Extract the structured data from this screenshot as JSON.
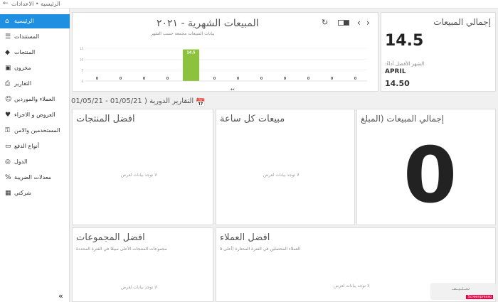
{
  "titlebar": {
    "back_icon": "arrow-left-icon",
    "breadcrumb": "الرئيسية • الاعدادات"
  },
  "sidebar": {
    "items": [
      {
        "label": "الرئيسية",
        "icon": "home-icon",
        "active": true
      },
      {
        "label": "المستندات",
        "icon": "document-icon"
      },
      {
        "label": "المنتجات",
        "icon": "tag-icon"
      },
      {
        "label": "مخزون",
        "icon": "box-icon"
      },
      {
        "label": "التقارير",
        "icon": "printer-icon"
      },
      {
        "label": "العملاء والموردين",
        "icon": "users-icon"
      },
      {
        "label": "العروض و الاجراء",
        "icon": "heart-icon"
      },
      {
        "label": "المستخدمين والامن",
        "icon": "key-icon"
      },
      {
        "label": "أنواع الدفع",
        "icon": "card-icon"
      },
      {
        "label": "الدول",
        "icon": "globe-icon"
      },
      {
        "label": "معدلات الضريبة",
        "icon": "percent-icon"
      },
      {
        "label": "شركتي",
        "icon": "building-icon"
      }
    ],
    "collapse_icon": "double-chevron-left-icon"
  },
  "monthly": {
    "title": "المبيعات الشهرية - ٢٠٢١",
    "subtitle": "بيانات المبيعات مجمعة حسب الشهر"
  },
  "chart_data": {
    "type": "bar",
    "categories": [
      "",
      "",
      "",
      "",
      "",
      "",
      "",
      "",
      "",
      "",
      "",
      ""
    ],
    "values": [
      0,
      0,
      0,
      0,
      14.5,
      0,
      0,
      0,
      0,
      0,
      0,
      0
    ],
    "ylim": [
      0,
      15
    ],
    "yticks": [
      0,
      5,
      10,
      15
    ],
    "data_labels": [
      "0",
      "0",
      "0",
      "0",
      "14.5",
      "0",
      "0",
      "0",
      "0",
      "0",
      "0",
      "0"
    ],
    "bar_color": "#8dc23f"
  },
  "total_sales": {
    "title": "إجمالي المبيعات",
    "value": "14.5",
    "best_month_label": "الشهر الأفضل أداءً:",
    "best_month": "APRIL",
    "best_month_value": "14.50"
  },
  "period": {
    "text": "01/05/21 - 01/05/21 ) التقارير الدورية ("
  },
  "panels": {
    "top_products": {
      "title": "افضل المنتجات",
      "nodata": "لا توجد بيانات لعرض"
    },
    "hourly": {
      "title": "مبيعات كل ساعة",
      "nodata": "لا توجد بيانات لعرض"
    },
    "total_amount": {
      "title": "إجمالي المبيعات (المبلغ",
      "value": "0"
    },
    "top_groups": {
      "title": "افضل المجموعات",
      "subtitle": "مجموعات المنتجات الأعلى مبيعًا في الفترة المحددة",
      "nodata": "لا توجد بيانات لعرض"
    },
    "top_customers": {
      "title": "افضل العملاء",
      "subtitle": "العملاء المحتملين في الفترة المختارة (أعلى ٥",
      "nodata": "لا توجد بيانات لعرض"
    }
  },
  "watermark": {
    "text": "سـتـيـمـ",
    "badge": "Screenpresso"
  }
}
